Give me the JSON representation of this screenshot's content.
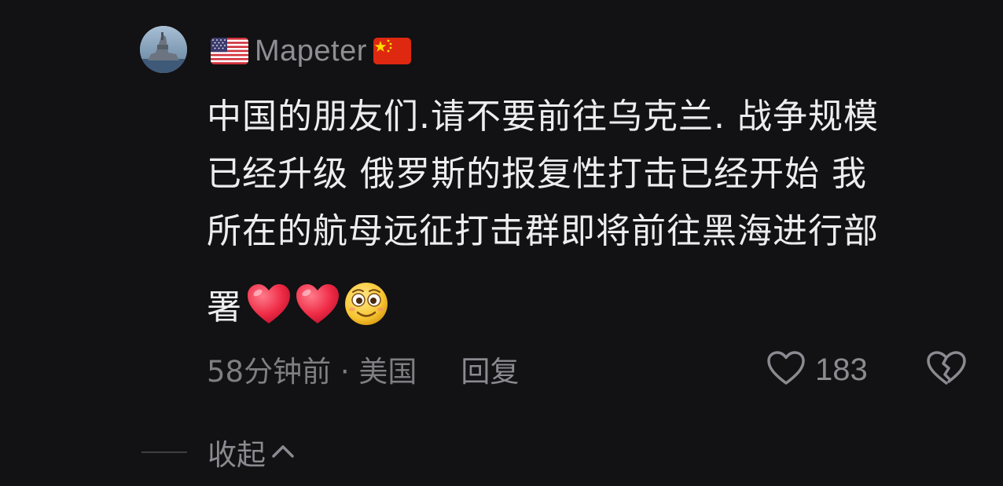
{
  "comment": {
    "user": {
      "name": "Mapeter",
      "flag_left": "us-flag-icon",
      "flag_right": "cn-flag-icon"
    },
    "text_lines": [
      "中国的朋友们.请不要前往乌克兰. 战争规模",
      "已经升级 俄罗斯的报复性打击已经开始 我",
      "所在的航母远征打击群即将前往黑海进行部"
    ],
    "last_line_text": "署",
    "emojis": [
      "red-heart-emoji",
      "red-heart-emoji",
      "smiling-face-emoji"
    ],
    "meta": {
      "time_location": "58分钟前 · 美国",
      "reply_label": "回复",
      "like_count": "183"
    },
    "collapse_label": "收起"
  },
  "colors": {
    "background": "#121113",
    "text_primary": "#ededef",
    "text_secondary": "#8a8a90",
    "heart_red": "#ee2a45"
  }
}
